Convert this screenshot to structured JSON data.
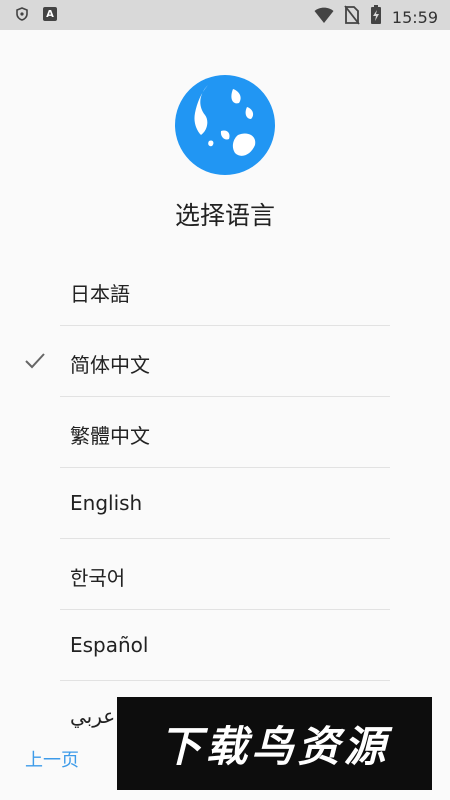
{
  "status_bar": {
    "time": "15:59",
    "left_icons": [
      "shield-icon",
      "a-icon"
    ],
    "right_icons": [
      "wifi-icon",
      "no-sim-icon",
      "battery-charging-icon"
    ]
  },
  "header": {
    "icon": "globe-icon",
    "title": "选择语言"
  },
  "languages": [
    {
      "label": "日本語",
      "selected": false
    },
    {
      "label": "简体中文",
      "selected": true
    },
    {
      "label": "繁體中文",
      "selected": false
    },
    {
      "label": "English",
      "selected": false
    },
    {
      "label": "한국어",
      "selected": false
    },
    {
      "label": "Español",
      "selected": false
    },
    {
      "label": "عربي",
      "selected": false
    }
  ],
  "footer": {
    "prev_label": "上一页"
  },
  "watermark": {
    "text": "下载鸟资源"
  },
  "colors": {
    "accent": "#3d9be9",
    "globe": "#2196f3",
    "status_bar": "#d9d9d9",
    "background": "#fafafa"
  }
}
